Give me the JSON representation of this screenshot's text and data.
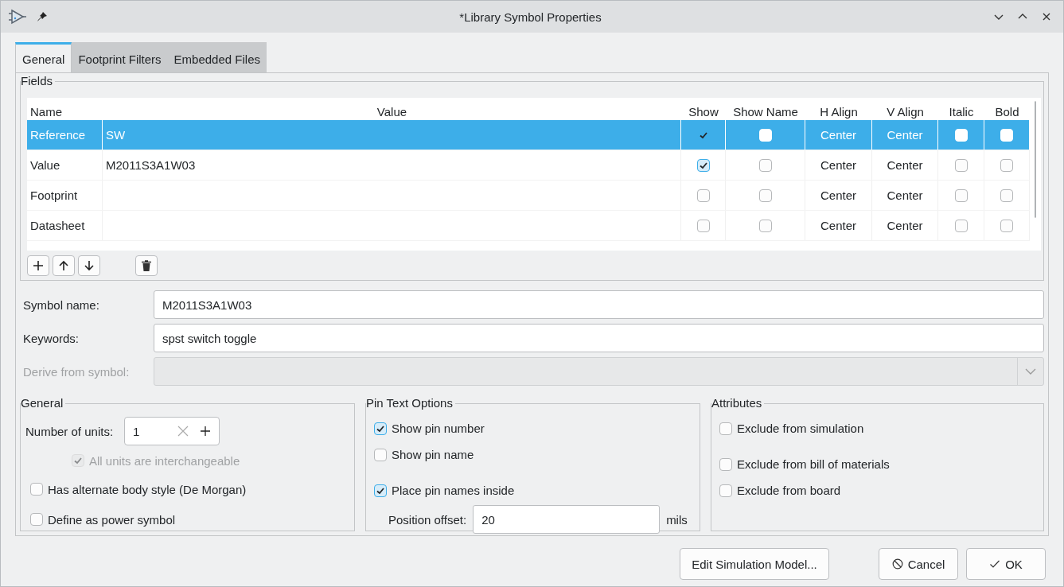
{
  "window": {
    "title": "*Library Symbol Properties"
  },
  "tabs": [
    {
      "label": "General",
      "selected": true
    },
    {
      "label": "Footprint Filters",
      "selected": false
    },
    {
      "label": "Embedded Files",
      "selected": false
    }
  ],
  "fields": {
    "title": "Fields",
    "columns": [
      "Name",
      "Value",
      "Show",
      "Show Name",
      "H Align",
      "V Align",
      "Italic",
      "Bold"
    ],
    "rows": [
      {
        "name": "Reference",
        "value": "SW",
        "show": true,
        "show_name": false,
        "h_align": "Center",
        "v_align": "Center",
        "italic": false,
        "bold": false,
        "selected": true
      },
      {
        "name": "Value",
        "value": "M2011S3A1W03",
        "show": true,
        "show_name": false,
        "h_align": "Center",
        "v_align": "Center",
        "italic": false,
        "bold": false,
        "selected": false
      },
      {
        "name": "Footprint",
        "value": "",
        "show": false,
        "show_name": false,
        "h_align": "Center",
        "v_align": "Center",
        "italic": false,
        "bold": false,
        "selected": false
      },
      {
        "name": "Datasheet",
        "value": "",
        "show": false,
        "show_name": false,
        "h_align": "Center",
        "v_align": "Center",
        "italic": false,
        "bold": false,
        "selected": false
      }
    ]
  },
  "properties": [
    {
      "kind": "text",
      "label": "Symbol name:",
      "value": "M2011S3A1W03"
    },
    {
      "kind": "text",
      "label": "Keywords:",
      "value": "spst switch toggle"
    },
    {
      "kind": "combo",
      "label": "Derive from symbol:",
      "disabled": true
    }
  ],
  "general": {
    "title": "General",
    "units_label": "Number of units:",
    "units_value": "1",
    "options": [
      {
        "label": "All units are interchangeable",
        "checked": true,
        "disabled": true
      },
      {
        "label": "Has alternate body style (De Morgan)",
        "checked": false,
        "disabled": false
      },
      {
        "label": "Define as power symbol",
        "checked": false,
        "disabled": false
      }
    ]
  },
  "pin_text": {
    "title": "Pin Text Options",
    "options": [
      {
        "label": "Show pin number",
        "checked": true
      },
      {
        "label": "Show pin name",
        "checked": false
      },
      {
        "label": "Place pin names inside",
        "checked": true
      }
    ],
    "offset_label": "Position offset:",
    "offset_value": "20",
    "offset_unit": "mils"
  },
  "attributes": {
    "title": "Attributes",
    "options": [
      {
        "label": "Exclude from simulation",
        "checked": false
      },
      {
        "label": "Exclude from bill of materials",
        "checked": false
      },
      {
        "label": "Exclude from board",
        "checked": false
      }
    ]
  },
  "buttons": [
    {
      "kind": "plain",
      "label": "Edit Simulation Model..."
    },
    {
      "kind": "cancel",
      "label": "Cancel"
    },
    {
      "kind": "ok",
      "label": "OK"
    }
  ]
}
